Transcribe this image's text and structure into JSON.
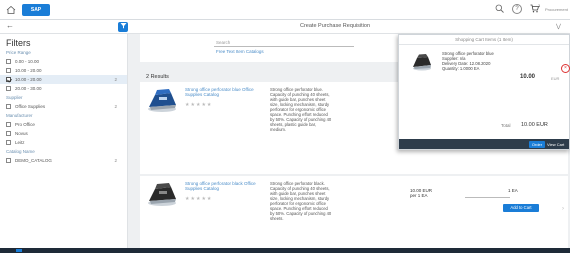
{
  "shell": {
    "logo": "SAP",
    "cart_count": "1",
    "user_label": "Procurement"
  },
  "subheader": {
    "title": "Create Purchase Requisition"
  },
  "sidebar": {
    "title": "Filters",
    "groups": [
      {
        "label": "Price Range",
        "items": [
          {
            "label": "0.00 - 10.00",
            "count": "",
            "checked": false
          },
          {
            "label": "10.00 - 20.00",
            "count": "",
            "checked": false
          },
          {
            "label": "10.00 - 20.00",
            "count": "2",
            "checked": true
          },
          {
            "label": "20.00 - 30.00",
            "count": "",
            "checked": false
          }
        ]
      },
      {
        "label": "Supplier",
        "items": [
          {
            "label": "Office Supplies",
            "count": "2",
            "checked": false
          }
        ]
      },
      {
        "label": "Manufacturer",
        "items": [
          {
            "label": "Pro Office",
            "count": "",
            "checked": false
          },
          {
            "label": "Novus",
            "count": "",
            "checked": false
          },
          {
            "label": "Leitz",
            "count": "",
            "checked": false
          }
        ]
      },
      {
        "label": "Catalog Name",
        "items": [
          {
            "label": "DEMO_CATALOG",
            "count": "2",
            "checked": false
          }
        ]
      }
    ]
  },
  "search": {
    "placeholder": "Search",
    "links": "Free Text Item   Catalogs"
  },
  "results": {
    "title": "2 Results",
    "items": [
      {
        "title": "Strong office perforator blue Office Supplies Catalog",
        "rating": "★★★★★",
        "description": "Strong office perforator blue. Capacity of punching 40 sheets, with guide bar, punches sheet size, locking mechanism, sturdy perforator for ergonomic office space. Punching effort reduced by 50%. Capacity of punching 40 sheets, plastic guide bar, medium.",
        "price": "",
        "unit": ""
      },
      {
        "title": "Strong office perforator black Office Supplies Catalog",
        "rating": "★★★★★",
        "description": "Strong office perforator black. Capacity of punching 40 sheets, with guide bar, punches sheet size, locking mechanism, sturdy perforator for ergonomic office space. Punching effort reduced by 50%. Capacity of punching 40 sheets.",
        "price": "10.00 EUR",
        "unit": "per 1 EA",
        "qty": "1",
        "qty_unit": "EA",
        "add_label": "Add to Cart"
      }
    ]
  },
  "popover": {
    "header": "Shopping Cart Items (1 Item)",
    "item_name": "Strong office perforator blue\nSupplier: n/a\nDelivery Date: 12.08.2020\nQuantity: 1.0000 EA",
    "item_price": "10.00",
    "item_price_unit": "EUR",
    "total_label": "Total",
    "total_value": "10.00 EUR",
    "order_label": "Order",
    "view_cart_label": "View Cart"
  },
  "colors": {
    "accent": "#1a7dd7",
    "footer": "#2d3c4b",
    "remove": "#dd3333"
  }
}
